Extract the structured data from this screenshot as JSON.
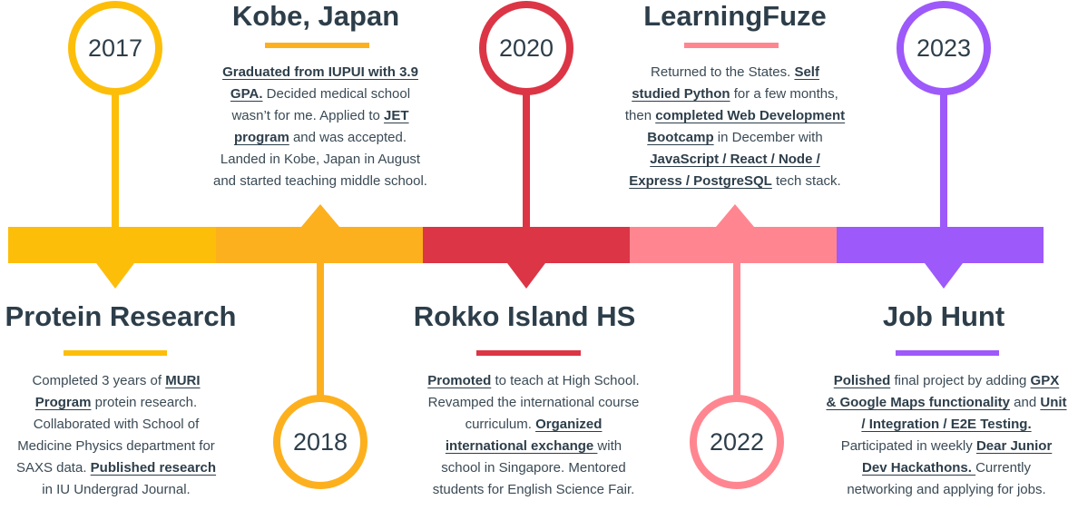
{
  "colors": {
    "c2017": "#fdbe0a",
    "c2018": "#fdb01e",
    "c2020": "#dc3545",
    "c2022": "#ff8690",
    "c2023": "#9d59fa",
    "text": "#2d3e4a"
  },
  "events": [
    {
      "year": "2017",
      "title": "Protein Research",
      "lines": [
        [
          {
            "t": "Completed 3 years of "
          },
          {
            "t": "MURI",
            "b": true
          }
        ],
        [
          {
            "t": "Program",
            "b": true
          },
          {
            "t": " protein research."
          }
        ],
        [
          {
            "t": "Collaborated with School of"
          }
        ],
        [
          {
            "t": "Medicine Physics department for"
          }
        ],
        [
          {
            "t": "SAXS data. "
          },
          {
            "t": "Published research",
            "b": true
          }
        ],
        [
          {
            "t": "in IU Undergrad Journal."
          }
        ]
      ]
    },
    {
      "year": "2018",
      "title": "Kobe, Japan",
      "lines": [
        [
          {
            "t": "Graduated from IUPUI with 3.9",
            "b": true
          }
        ],
        [
          {
            "t": "GPA.",
            "b": true
          },
          {
            "t": " Decided medical school"
          }
        ],
        [
          {
            "t": "wasn’t for me. Applied to "
          },
          {
            "t": "JET",
            "b": true
          }
        ],
        [
          {
            "t": "program",
            "b": true
          },
          {
            "t": " and was accepted."
          }
        ],
        [
          {
            "t": "Landed in Kobe, Japan in August"
          }
        ],
        [
          {
            "t": "and started teaching middle school."
          }
        ]
      ]
    },
    {
      "year": "2020",
      "title": "Rokko Island HS",
      "lines": [
        [
          {
            "t": "Promoted",
            "b": true
          },
          {
            "t": " to teach at High School."
          }
        ],
        [
          {
            "t": "Revamped the international course"
          }
        ],
        [
          {
            "t": "curriculum. "
          },
          {
            "t": "Organized",
            "b": true
          }
        ],
        [
          {
            "t": "international exchange ",
            "b": true
          },
          {
            "t": "with"
          }
        ],
        [
          {
            "t": "school in Singapore. Mentored"
          }
        ],
        [
          {
            "t": "students for English Science Fair."
          }
        ]
      ]
    },
    {
      "year": "2022",
      "title": "LearningFuze",
      "lines": [
        [
          {
            "t": "Returned to the States. "
          },
          {
            "t": "Self",
            "b": true
          }
        ],
        [
          {
            "t": "studied Python",
            "b": true
          },
          {
            "t": " for a few months,"
          }
        ],
        [
          {
            "t": "then "
          },
          {
            "t": "completed Web Development",
            "b": true
          }
        ],
        [
          {
            "t": "Bootcamp",
            "b": true
          },
          {
            "t": " in December with"
          }
        ],
        [
          {
            "t": "JavaScript / React / Node /",
            "b": true
          }
        ],
        [
          {
            "t": "Express / PostgreSQL",
            "b": true
          },
          {
            "t": " tech stack."
          }
        ]
      ]
    },
    {
      "year": "2023",
      "title": "Job Hunt",
      "lines": [
        [
          {
            "t": "Polished",
            "b": true
          },
          {
            "t": " final project by adding "
          },
          {
            "t": "GPX",
            "b": true
          }
        ],
        [
          {
            "t": "& Google Maps functionality",
            "b": true
          },
          {
            "t": " and "
          },
          {
            "t": "Unit",
            "b": true
          }
        ],
        [
          {
            "t": "/ Integration / E2E Testing.",
            "b": true
          }
        ],
        [
          {
            "t": "Participated in weekly "
          },
          {
            "t": "Dear Junior",
            "b": true
          }
        ],
        [
          {
            "t": "Dev Hackathons. ",
            "b": true
          },
          {
            "t": " Currently"
          }
        ],
        [
          {
            "t": "networking and applying for jobs."
          }
        ]
      ]
    }
  ]
}
